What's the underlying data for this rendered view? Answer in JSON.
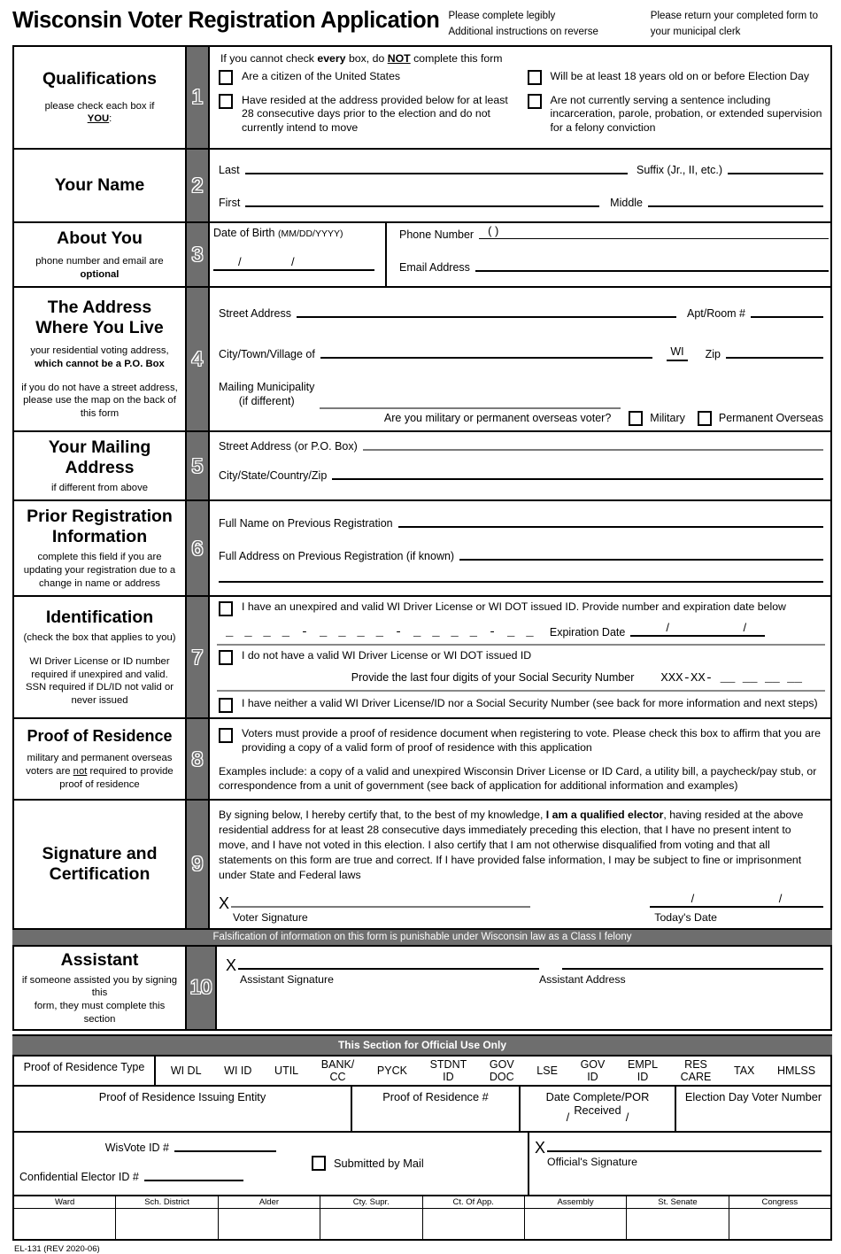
{
  "header": {
    "title": "Wisconsin Voter Registration Application",
    "note_left_line1": "Please complete legibly",
    "note_left_line2": "Additional instructions on reverse",
    "note_right_line1": "Please return your completed form to",
    "note_right_line2": "your municipal clerk"
  },
  "sections": {
    "qualifications": {
      "number": "1",
      "title": "Qualifications",
      "sub_pre": "please check each box if",
      "sub_you": "YOU",
      "sub_post": ":",
      "instruction_a": "If you cannot check ",
      "instruction_every": "every",
      "instruction_b": " box, do ",
      "instruction_not": "NOT",
      "instruction_c": " complete this form",
      "items": [
        "Are a citizen of the United States",
        "Have resided at the address provided below for at least 28 consecutive days prior to the election and do not currently intend to move",
        "Will be at least 18 years old on or before Election Day",
        "Are not currently serving a sentence including incarceration, parole, probation, or extended supervision for a felony conviction"
      ]
    },
    "name": {
      "number": "2",
      "title": "Your Name",
      "last_label": "Last",
      "suffix_label": "Suffix (Jr., II, etc.)",
      "first_label": "First",
      "middle_label": "Middle"
    },
    "about": {
      "number": "3",
      "title": "About You",
      "sub_line1": "phone number and email are",
      "sub_bold": "optional",
      "dob_label": "Date of Birth",
      "dob_format": "(MM/DD/YYYY)",
      "dob_slashes": "/        /",
      "phone_label": "Phone Number",
      "phone_parens": "(                )",
      "email_label": "Email Address"
    },
    "address": {
      "number": "4",
      "title_line1": "The Address",
      "title_line2": "Where You Live",
      "sub_line1": "your residential voting address,",
      "sub_bold": "which cannot be a P.O. Box",
      "sub2_line1": "if you do not have a street address,",
      "sub2_line2": "please use the map on the back of",
      "sub2_line3": "this form",
      "street_label": "Street Address",
      "apt_label": "Apt/Room #",
      "city_label": "City/Town/Village of",
      "state_value": "WI",
      "zip_label": "Zip",
      "mailing_label_line1": "Mailing Municipality",
      "mailing_label_line2": "(if different)",
      "military_question": "Are you military or permanent overseas voter?",
      "military_label": "Military",
      "overseas_label": "Permanent Overseas"
    },
    "mailing": {
      "number": "5",
      "title_line1": "Your Mailing",
      "title_line2": "Address",
      "sub": "if different from above",
      "street_label": "Street Address (or P.O. Box)",
      "csz_label": "City/State/Country/Zip"
    },
    "prior": {
      "number": "6",
      "title_line1": "Prior Registration",
      "title_line2": "Information",
      "sub_line1": "complete this field if you are",
      "sub_line2": "updating your registration due to a",
      "sub_line3": "change in name or address",
      "fullname_label": "Full Name on Previous Registration",
      "fulladdr_label": "Full Address on Previous Registration (if known)"
    },
    "identification": {
      "number": "7",
      "title": "Identification",
      "sub_line1": "(check the box that applies to you)",
      "sub2_line1": "WI Driver License or ID number",
      "sub2_line2": "required if unexpired and valid.",
      "sub2_line3": "SSN required if DL/ID not valid or",
      "sub2_line4": "never issued",
      "option1": "I have an unexpired and valid WI Driver License or WI DOT issued ID.  Provide number and expiration date below",
      "dl_mask": "_ _ _ _ - _ _ _ _ - _ _ _ _ - _ _",
      "expiration_label": "Expiration Date",
      "expiration_slashes": "/            /",
      "option2": "I do not have a valid WI Driver License or WI DOT issued ID",
      "ssn_prompt": "Provide the last four digits of your Social Security Number",
      "ssn_mask": "XXX-XX- __  __  __  __",
      "option3": "I have neither a valid WI Driver License/ID nor a Social Security Number (see back for more information and next steps)"
    },
    "proof": {
      "number": "8",
      "title": "Proof of Residence",
      "sub_a": "military and permanent overseas",
      "sub_b_pre": "voters are ",
      "sub_b_not": "not",
      "sub_b_post": " required to provide",
      "sub_c": "proof of residence",
      "checkbox_text": "Voters must provide a proof of residence document when registering to vote.  Please check this box to affirm that you are providing a copy of a valid form of proof of residence with this application",
      "examples_text": "Examples include: a copy of a valid and unexpired Wisconsin Driver License or ID Card, a utility bill, a paycheck/pay stub, or correspondence from a unit of government (see back of application for additional information and examples)"
    },
    "signature": {
      "number": "9",
      "title_line1": "Signature and",
      "title_line2": "Certification",
      "cert_a": "By signing below, I hereby certify that, to the best of my knowledge, ",
      "cert_bold": "I am a qualified elector",
      "cert_b": ", having resided at the above residential address for at least 28 consecutive days immediately preceding this election, that I have no present intent to move, and I have not voted in this election.  I also certify that I am not otherwise disqualified from voting and that all statements on this form are true and correct.  If I have provided false information, I may be subject to fine or imprisonment under State and Federal laws",
      "x_mark": "X",
      "voter_sig_label": "Voter Signature",
      "todays_date_label": "Today's Date",
      "date_slashes": "/            /"
    },
    "falsification_banner": "Falsification of information on this form is punishable under Wisconsin law as a Class I felony",
    "assistant": {
      "number": "10",
      "title": "Assistant",
      "sub_line1": "if someone assisted you by signing this",
      "sub_line2": "form, they must complete this section",
      "x_mark": "X",
      "assistant_sig_label": "Assistant Signature",
      "assistant_addr_label": "Assistant Address"
    }
  },
  "official": {
    "banner": "This Section for Official Use Only",
    "por_type_label": "Proof of Residence Type",
    "por_types": [
      "WI DL",
      "WI ID",
      "UTIL",
      "BANK/\nCC",
      "PYCK",
      "STDNT\nID",
      "GOV\nDOC",
      "LSE",
      "GOV\nID",
      "EMPL\nID",
      "RES\nCARE",
      "TAX",
      "HMLSS"
    ],
    "issuing_entity_label": "Proof of Residence Issuing Entity",
    "por_number_label": "Proof of Residence #",
    "date_complete_label": "Date Complete/POR Received",
    "date_slashes": "/        /",
    "edvn_label": "Election Day Voter Number",
    "wisvote_label": "WisVote ID #",
    "confidential_label": "Confidential Elector ID #",
    "submitted_by_mail_label": "Submitted by Mail",
    "x_mark": "X",
    "officials_sig_label": "Official's Signature",
    "ward_headers": [
      "Ward",
      "Sch. District",
      "Alder",
      "Cty. Supr.",
      "Ct. Of App.",
      "Assembly",
      "St. Senate",
      "Congress"
    ]
  },
  "footer": {
    "form_id": "EL-131 (REV 2020-06)"
  }
}
